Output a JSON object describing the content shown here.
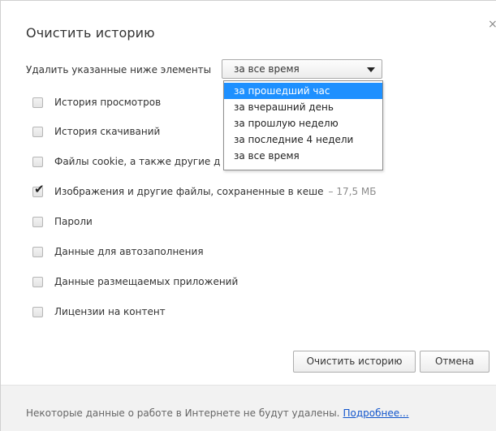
{
  "dialog": {
    "title": "Очистить историю",
    "close_glyph": "×"
  },
  "period": {
    "label": "Удалить указанные ниже элементы",
    "selected": "за все время",
    "options": [
      "за прошедший час",
      "за вчерашний день",
      "за прошлую неделю",
      "за последние 4 недели",
      "за все время"
    ],
    "highlighted_option": "за прошедший час"
  },
  "items": [
    {
      "label": "История просмотров",
      "checked": false,
      "size": ""
    },
    {
      "label": "История скачиваний",
      "checked": false,
      "size": ""
    },
    {
      "label": "Файлы cookie, а также другие д",
      "checked": false,
      "size": ""
    },
    {
      "label": "Изображения и другие файлы, сохраненные в кеше",
      "checked": true,
      "size": "–  17,5 МБ"
    },
    {
      "label": "Пароли",
      "checked": false,
      "size": ""
    },
    {
      "label": "Данные для автозаполнения",
      "checked": false,
      "size": ""
    },
    {
      "label": "Данные размещаемых приложений",
      "checked": false,
      "size": ""
    },
    {
      "label": "Лицензии на контент",
      "checked": false,
      "size": ""
    }
  ],
  "buttons": {
    "clear": "Очистить историю",
    "cancel": "Отмена"
  },
  "footer": {
    "text": "Некоторые данные о работе в Интернете не будут удалены.",
    "link": "Подробнее..."
  },
  "icons": {
    "checkmark": "✔",
    "dropdown_arrow": "chevron-down-icon"
  },
  "colors": {
    "highlight": "#1e90ff",
    "link": "#1155cc",
    "footer_bg": "#f2f2f2"
  }
}
